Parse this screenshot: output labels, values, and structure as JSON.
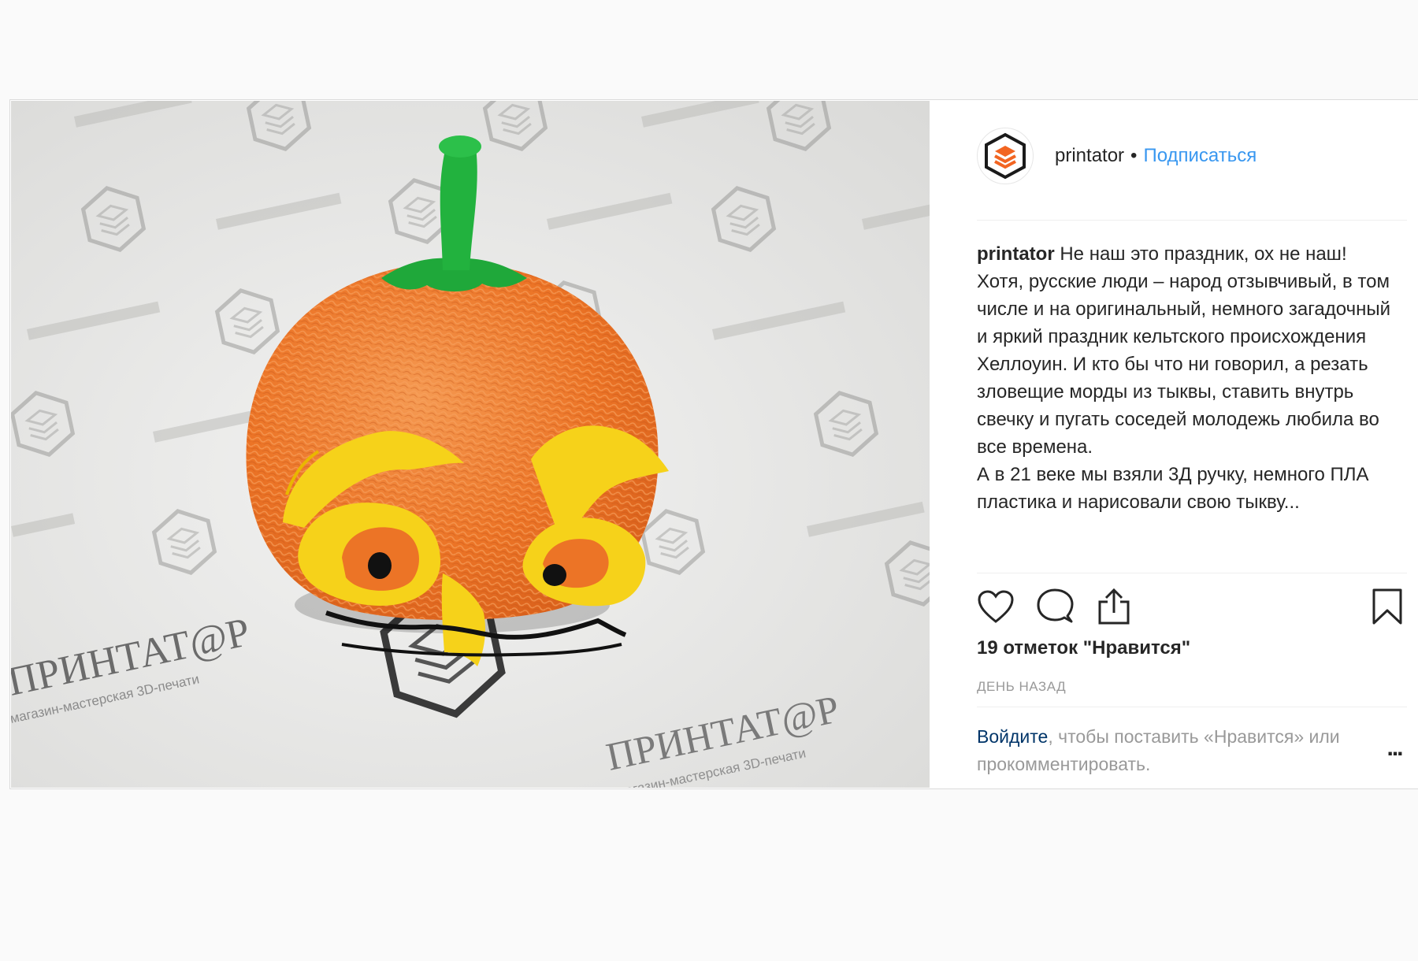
{
  "post": {
    "username": "printator",
    "separator": "•",
    "follow_label": "Подписаться",
    "caption_author": "printator",
    "caption_text": " Не наш это праздник, ох не наш! Хотя, русские люди – народ отзывчивый, в том числе и на оригинальный, немного загадочный и яркий праздник кельтского происхождения Хеллоуин. И кто бы что ни говорил, а резать зловещие морды из тыквы, ставить внутрь свечку и пугать соседей молодежь любила во все времена.\nА в 21 веке мы взяли 3Д ручку, немного ПЛА пластика и нарисовали свою тыкву...",
    "likes_text": "19 отметок \"Нравится\"",
    "time_text": "ДЕНЬ НАЗАД",
    "login_link": "Войдите",
    "login_text": ", чтобы поставить «Нравится» или прокомментировать.",
    "more_label": "..."
  },
  "photo": {
    "backdrop_brand": "ПРИНТАТ@Р",
    "backdrop_tagline": "магазин-мастерская 3D-печати"
  },
  "icons": {
    "avatar": "printator-logo-icon",
    "like": "heart-icon",
    "comment": "comment-bubble-icon",
    "share": "share-upload-icon",
    "save": "bookmark-icon"
  },
  "colors": {
    "link_blue": "#3897f0",
    "login_link": "#003569",
    "pumpkin_orange": "#f07830",
    "stem_green": "#1fa83a",
    "face_yellow": "#f6d21a",
    "logo_orange": "#f26522"
  }
}
